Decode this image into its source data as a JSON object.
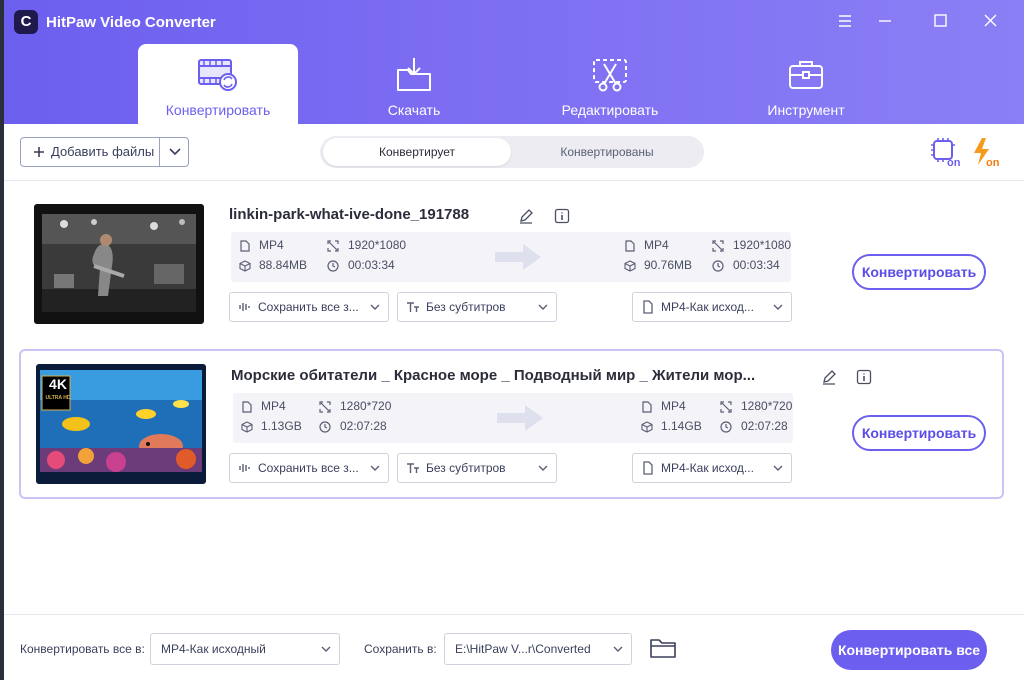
{
  "app": {
    "title": "HitPaw Video Converter",
    "logo": "C"
  },
  "tabs": [
    {
      "label": "Конвертировать",
      "icon": "film-convert-icon"
    },
    {
      "label": "Скачать",
      "icon": "download-folder-icon"
    },
    {
      "label": "Редактировать",
      "icon": "edit-cut-icon"
    },
    {
      "label": "Инструмент",
      "icon": "toolbox-icon"
    }
  ],
  "toolbar": {
    "add_files": "Добавить файлы",
    "seg_converting": "Конвертирует",
    "seg_converted": "Конвертированы",
    "hw_accel_icon": "hardware-acceleration-on-icon",
    "lightning_icon": "lightning-on-icon"
  },
  "files": [
    {
      "name": "linkin-park-what-ive-done_191788",
      "src": {
        "format": "MP4",
        "resolution": "1920*1080",
        "size": "88.84MB",
        "duration": "00:03:34"
      },
      "dst": {
        "format": "MP4",
        "resolution": "1920*1080",
        "size": "90.76MB",
        "duration": "00:03:34"
      },
      "audio": "Сохранить все з...",
      "subtitles": "Без субтитров",
      "output_format": "MP4-Как исход...",
      "convert": "Конвертировать"
    },
    {
      "name": "Морские обитатели _ Красное море _ Подводный мир _ Жители мор...",
      "thumb_badge": "4K",
      "thumb_badge_sub": "ULTRA HD",
      "src": {
        "format": "MP4",
        "resolution": "1280*720",
        "size": "1.13GB",
        "duration": "02:07:28"
      },
      "dst": {
        "format": "MP4",
        "resolution": "1280*720",
        "size": "1.14GB",
        "duration": "02:07:28"
      },
      "audio": "Сохранить все з...",
      "subtitles": "Без субтитров",
      "output_format": "MP4-Как исход...",
      "convert": "Конвертировать"
    }
  ],
  "footer": {
    "convert_all_to_label": "Конвертировать все в:",
    "convert_all_to_value": "MP4-Как исходный",
    "save_to_label": "Сохранить в:",
    "save_to_value": "E:\\HitPaw V...r\\Converted",
    "convert_all_button": "Конвертировать все"
  },
  "colors": {
    "accent": "#6c5fef",
    "accent_light": "#8b7ff5",
    "text": "#2b2d3a"
  }
}
